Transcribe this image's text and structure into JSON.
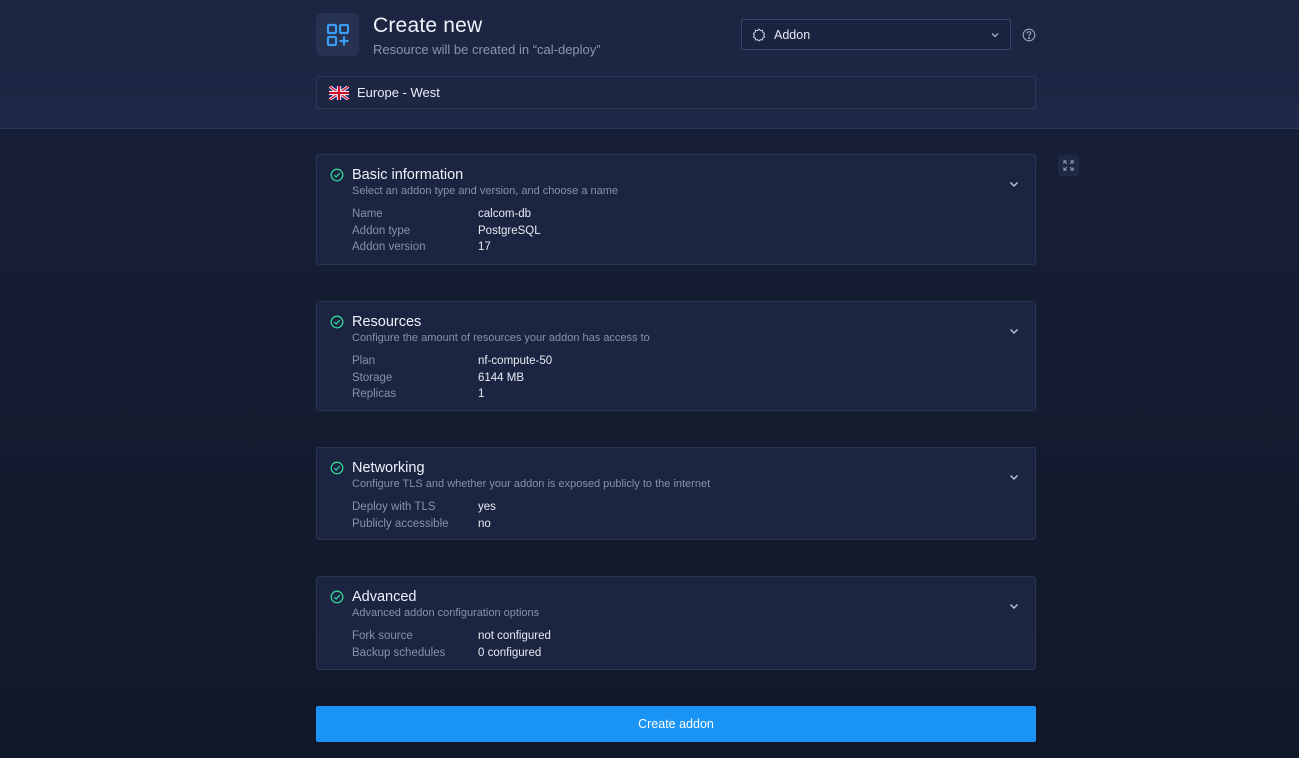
{
  "header": {
    "title": "Create new",
    "subtitle": "Resource will be created in “cal-deploy”",
    "icon": "add-grid-icon"
  },
  "type_select": {
    "value": "Addon",
    "icon": "package-icon"
  },
  "region": {
    "label": "Europe - West",
    "flag": "uk-flag"
  },
  "cards": [
    {
      "title": "Basic information",
      "description": "Select an addon type and version, and choose a name",
      "rows": [
        {
          "key": "Name",
          "value": "calcom-db"
        },
        {
          "key": "Addon type",
          "value": "PostgreSQL"
        },
        {
          "key": "Addon version",
          "value": "17"
        }
      ]
    },
    {
      "title": "Resources",
      "description": "Configure the amount of resources your addon has access to",
      "rows": [
        {
          "key": "Plan",
          "value": "nf-compute-50"
        },
        {
          "key": "Storage",
          "value": "6144 MB"
        },
        {
          "key": "Replicas",
          "value": "1"
        }
      ]
    },
    {
      "title": "Networking",
      "description": "Configure TLS and whether your addon is exposed publicly to the internet",
      "rows": [
        {
          "key": "Deploy with TLS",
          "value": "yes"
        },
        {
          "key": "Publicly accessible",
          "value": "no"
        }
      ]
    },
    {
      "title": "Advanced",
      "description": "Advanced addon configuration options",
      "rows": [
        {
          "key": "Fork source",
          "value": "not configured"
        },
        {
          "key": "Backup schedules",
          "value": "0 configured"
        }
      ]
    }
  ],
  "create_button": {
    "label": "Create addon"
  },
  "colors": {
    "accent": "#1a94f5",
    "success": "#34d399",
    "icon_blue": "#3b9cf5"
  }
}
